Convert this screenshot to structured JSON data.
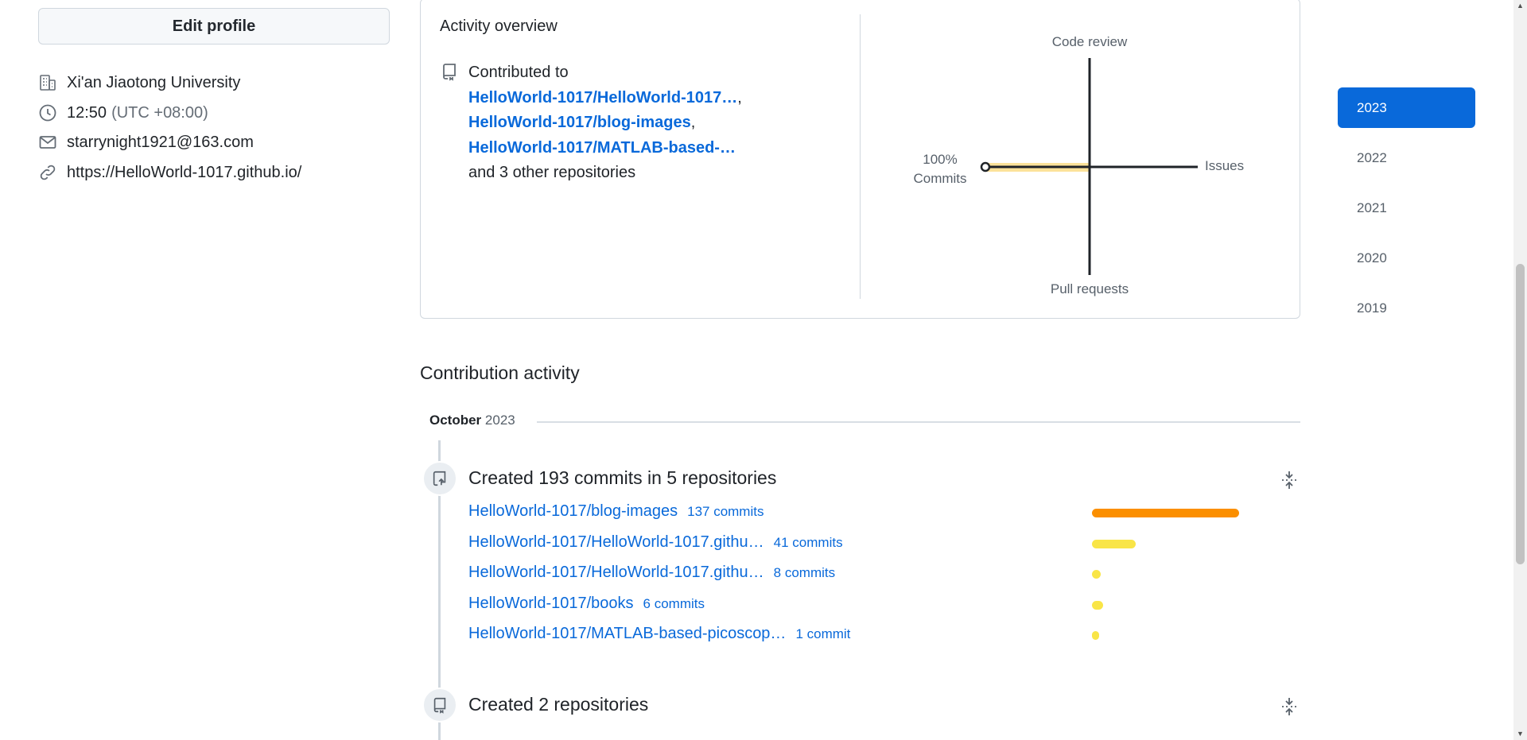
{
  "profile": {
    "edit_button": "Edit profile",
    "organization": "Xi'an Jiaotong University",
    "time": "12:50",
    "timezone": "(UTC +08:00)",
    "email": "starrynight1921@163.com",
    "website": "https://HelloWorld-1017.github.io/"
  },
  "overview": {
    "title": "Activity overview",
    "contributed_to": "Contributed to",
    "repos": [
      "HelloWorld-1017/HelloWorld-1017…",
      "HelloWorld-1017/blog-images",
      "HelloWorld-1017/MATLAB-based-…"
    ],
    "sep1": ",",
    "sep2": ",",
    "others": "and 3 other repositories",
    "axes": {
      "top": "Code review",
      "right": "Issues",
      "bottom": "Pull requests",
      "left_percent": "100%",
      "left_label": "Commits"
    },
    "commits_share_percent": 100
  },
  "years": {
    "items": [
      "2023",
      "2022",
      "2021",
      "2020",
      "2019"
    ],
    "active": "2023"
  },
  "activity": {
    "title": "Contribution activity",
    "month": "October",
    "year": "2023",
    "event1": {
      "title": "Created 193 commits in 5 repositories",
      "rows": [
        {
          "repo": "HelloWorld-1017/blog-images",
          "count": "137 commits",
          "value": 137
        },
        {
          "repo": "HelloWorld-1017/HelloWorld-1017.githu…",
          "count": "41 commits",
          "value": 41
        },
        {
          "repo": "HelloWorld-1017/HelloWorld-1017.githu…",
          "count": "8 commits",
          "value": 8
        },
        {
          "repo": "HelloWorld-1017/books",
          "count": "6 commits",
          "value": 6
        },
        {
          "repo": "HelloWorld-1017/MATLAB-based-picoscop…",
          "count": "1 commit",
          "value": 1
        }
      ]
    },
    "event2": {
      "title": "Created 2 repositories"
    }
  },
  "colors": {
    "accent": "#0969da",
    "bar_orange": "#fb8f00",
    "bar_yellow": "#f9e547",
    "overview_highlight": "#fce29a"
  }
}
